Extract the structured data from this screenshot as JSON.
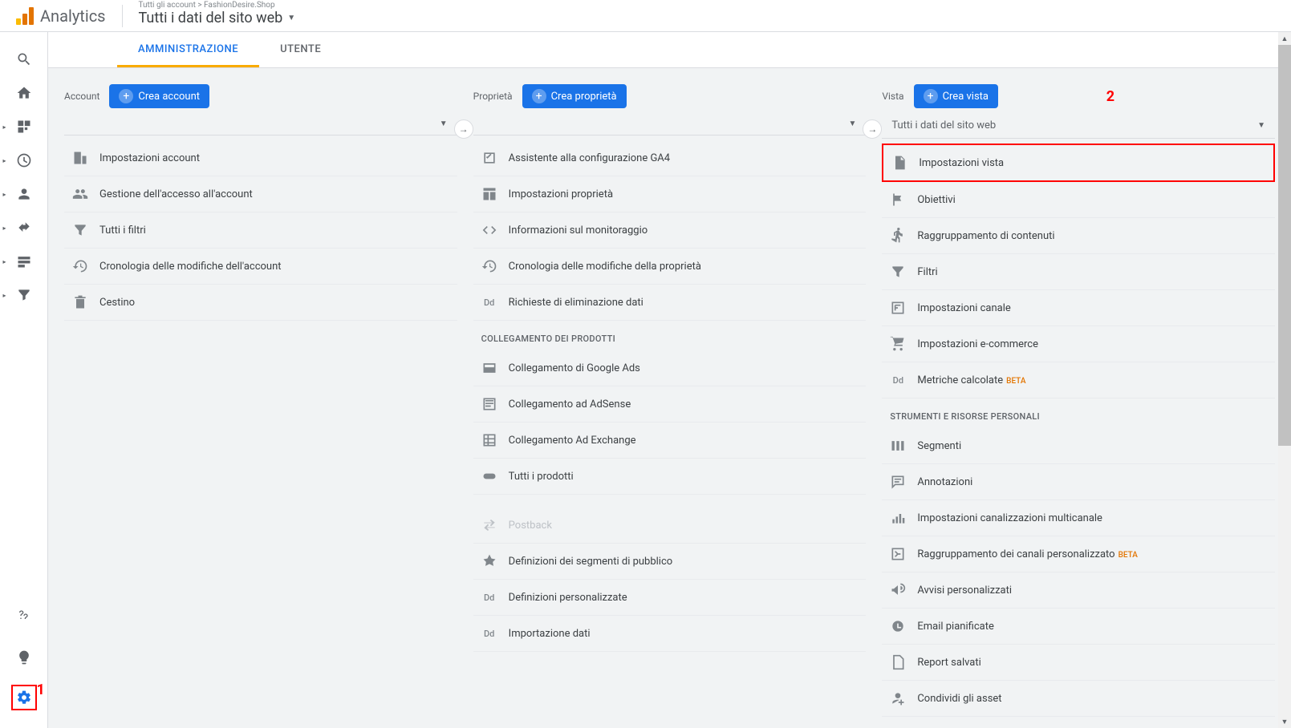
{
  "header": {
    "app_name": "Analytics",
    "breadcrumb": "Tutti gli account > FashionDesire.Shop",
    "view_title": "Tutti i dati del sito web"
  },
  "tabs": {
    "admin": "AMMINISTRAZIONE",
    "user": "UTENTE"
  },
  "account_col": {
    "label": "Account",
    "create_btn": "Crea account",
    "selector": "",
    "items": [
      {
        "label": "Impostazioni account"
      },
      {
        "label": "Gestione dell'accesso all'account"
      },
      {
        "label": "Tutti i filtri"
      },
      {
        "label": "Cronologia delle modifiche dell'account"
      },
      {
        "label": "Cestino"
      }
    ]
  },
  "property_col": {
    "label": "Proprietà",
    "create_btn": "Crea proprietà",
    "selector": "",
    "items": [
      {
        "label": "Assistente alla configurazione GA4"
      },
      {
        "label": "Impostazioni proprietà"
      },
      {
        "label": "Informazioni sul monitoraggio"
      },
      {
        "label": "Cronologia delle modifiche della proprietà"
      },
      {
        "label": "Richieste di eliminazione dati"
      }
    ],
    "section1_header": "COLLEGAMENTO DEI PRODOTTI",
    "linking_items": [
      {
        "label": "Collegamento di Google Ads"
      },
      {
        "label": "Collegamento ad AdSense"
      },
      {
        "label": "Collegamento Ad Exchange"
      },
      {
        "label": "Tutti i prodotti"
      }
    ],
    "misc_items": [
      {
        "label": "Postback",
        "disabled": true
      },
      {
        "label": "Definizioni dei segmenti di pubblico"
      },
      {
        "label": "Definizioni personalizzate"
      },
      {
        "label": "Importazione dati"
      }
    ]
  },
  "view_col": {
    "label": "Vista",
    "create_btn": "Crea vista",
    "selector": "Tutti i dati del sito web",
    "items_top": [
      {
        "label": "Impostazioni vista",
        "highlight": true
      },
      {
        "label": "Obiettivi"
      },
      {
        "label": "Raggruppamento di contenuti"
      },
      {
        "label": "Filtri"
      },
      {
        "label": "Impostazioni canale"
      },
      {
        "label": "Impostazioni e-commerce"
      },
      {
        "label": "Metriche calcolate",
        "beta": "BETA"
      }
    ],
    "section_header": "STRUMENTI E RISORSE PERSONALI",
    "items_bottom": [
      {
        "label": "Segmenti"
      },
      {
        "label": "Annotazioni"
      },
      {
        "label": "Impostazioni canalizzazioni multicanale"
      },
      {
        "label": "Raggruppamento dei canali personalizzato",
        "beta": "BETA"
      },
      {
        "label": "Avvisi personalizzati"
      },
      {
        "label": "Email pianificate"
      },
      {
        "label": "Report salvati"
      },
      {
        "label": "Condividi gli asset"
      }
    ]
  },
  "annotations": {
    "n1": "1",
    "n2": "2"
  }
}
